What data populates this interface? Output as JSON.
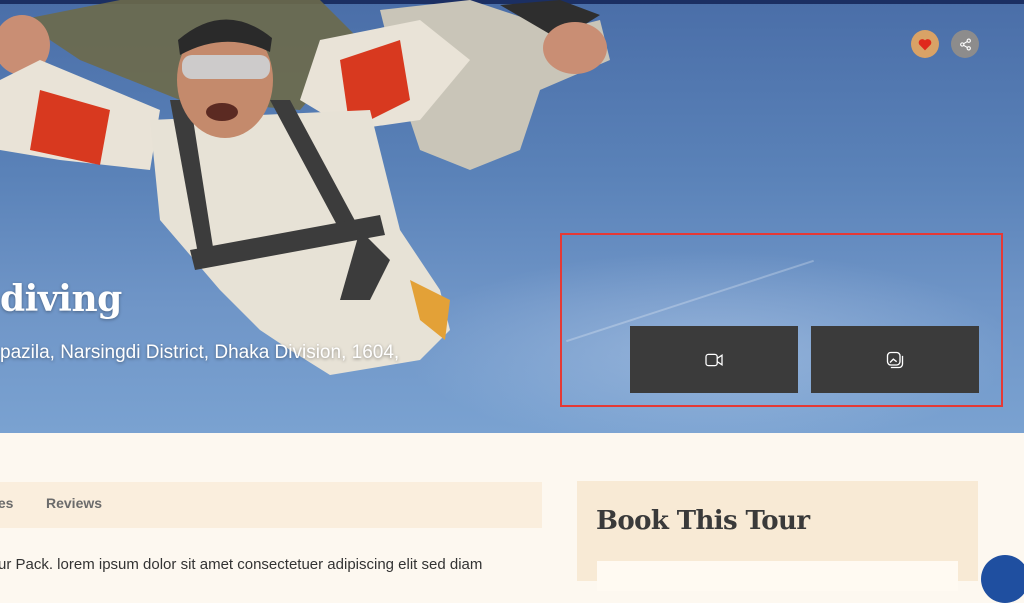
{
  "hero": {
    "title": "diving",
    "location": "pazila, Narsingdi District, Dhaka Division, 1604,",
    "favorite_icon": "heart-icon",
    "share_icon": "share-icon",
    "video_icon": "video-camera-icon",
    "gallery_icon": "gallery-icon",
    "colors": {
      "favorite_bg": "#d9a266",
      "heart": "#e0291c",
      "share_bg": "#8d8c8c",
      "media_button_bg": "#3b3b3b",
      "highlight_border": "#e53935"
    }
  },
  "tabs": {
    "items": [
      {
        "label": "ies"
      },
      {
        "label": "Reviews"
      }
    ]
  },
  "description": {
    "text": "ur Pack. lorem ipsum dolor sit amet consectetuer adipiscing elit sed diam"
  },
  "booking": {
    "title": "Book This Tour"
  },
  "chat": {
    "icon": "chat-icon",
    "color": "#1f4fa0"
  }
}
